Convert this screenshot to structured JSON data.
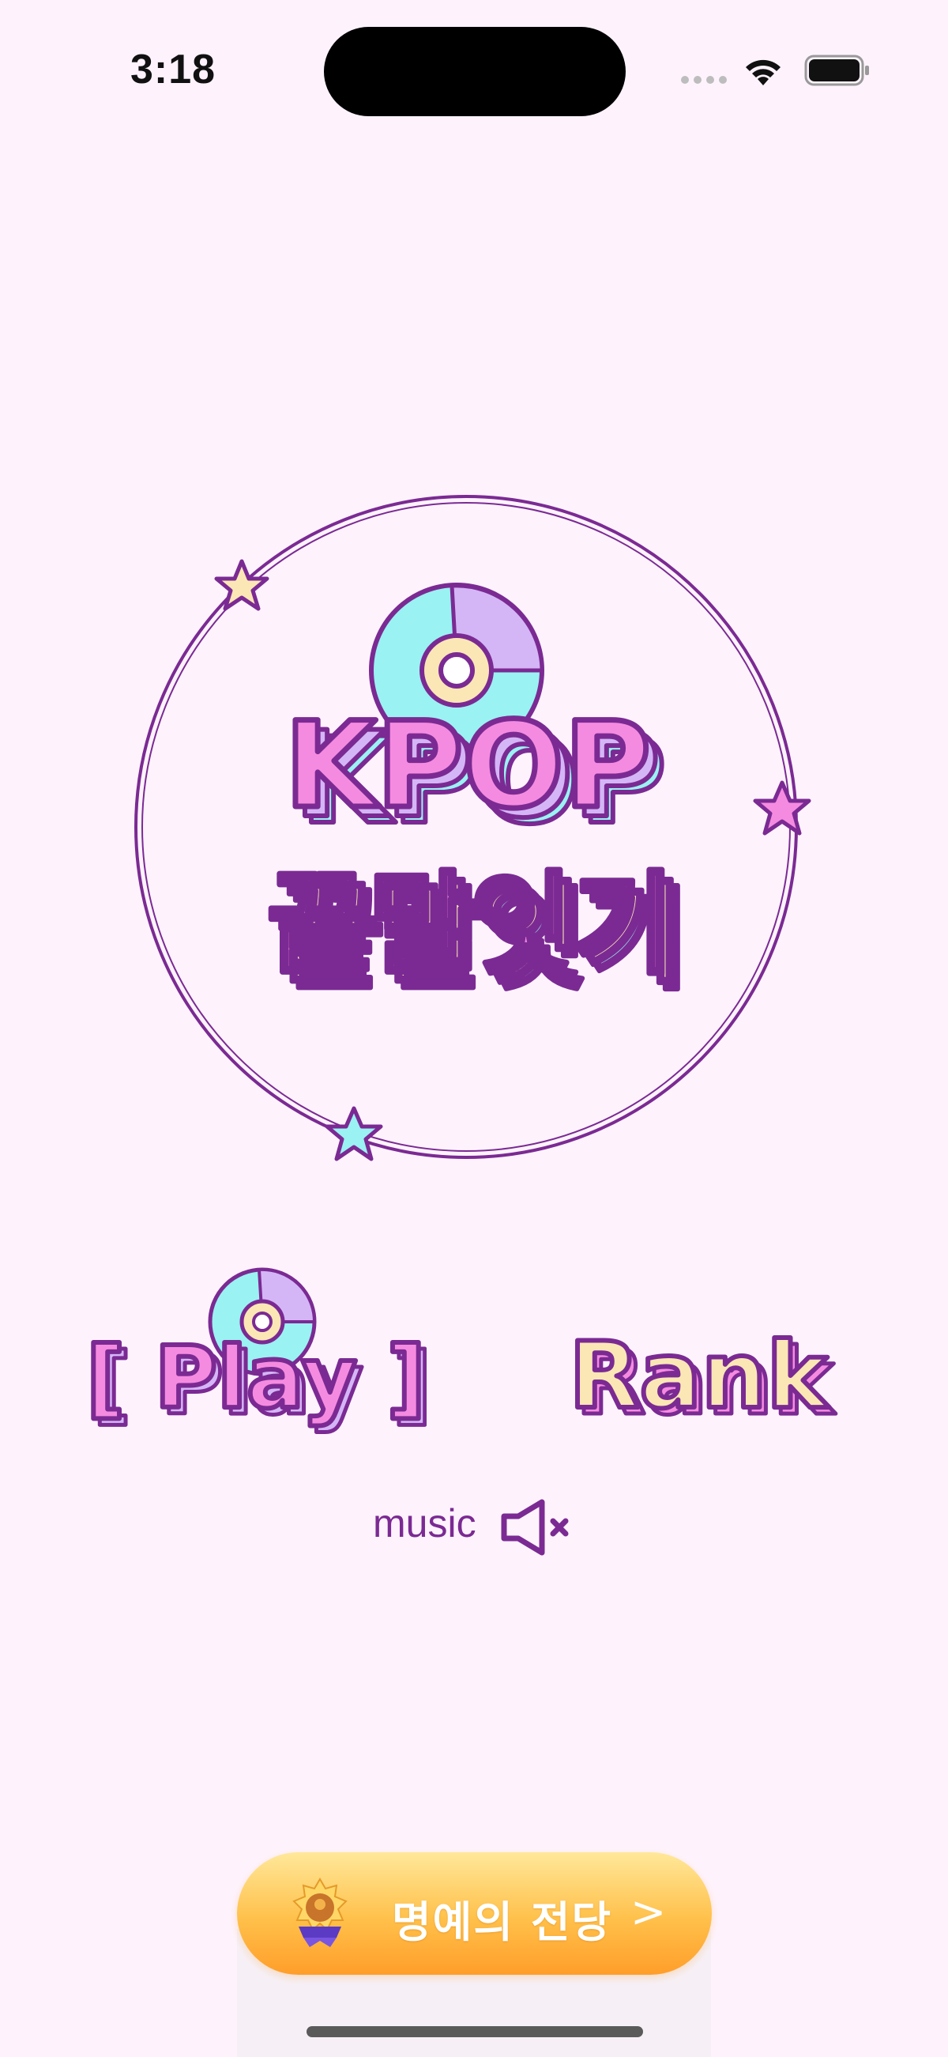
{
  "status_bar": {
    "time": "3:18"
  },
  "logo": {
    "title_line1": "KPOP",
    "title_line2": "끝말잇기"
  },
  "menu": {
    "play_label": "[ Play ]",
    "rank_label": "Rank",
    "music_label": "music",
    "music_state": "muted"
  },
  "hall_of_fame": {
    "label": "명예의 전당",
    "chevron": ">"
  },
  "colors": {
    "background": "#FEF3FD",
    "accent_purple": "#7B2A93",
    "pink": "#F58BE0",
    "cyan": "#9AF2F2",
    "lavender": "#D4B6F6",
    "cream": "#FBE7B5",
    "orange_button": "#FFB23F"
  }
}
